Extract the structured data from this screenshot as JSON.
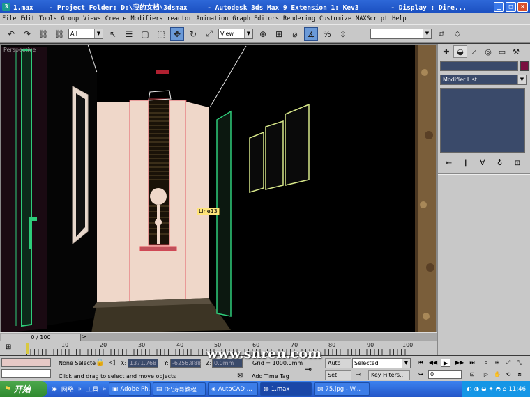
{
  "window": {
    "icon": "3ds-max-icon",
    "title": "1.max    - Project Folder: D:\\我的文档\\3dsmax     - Autodesk 3ds Max 9 Extension 1: Kev3        - Display : Dire...",
    "controls": {
      "minimize": "_",
      "maximize": "□",
      "close": "×"
    }
  },
  "menu": [
    "File",
    "Edit",
    "Tools",
    "Group",
    "Views",
    "Create",
    "Modifiers",
    "reactor",
    "Animation",
    "Graph Editors",
    "Rendering",
    "Customize",
    "MAXScript",
    "Help"
  ],
  "toolbar": {
    "undo": "↶",
    "redo": "↷",
    "link": "⛓",
    "unlink": "⛓",
    "selection_filter": "All",
    "select": "↖",
    "select_by_name": "☰",
    "region": "▢",
    "window_crossing": "⬚",
    "move": "✥",
    "rotate": "↻",
    "scale": "⤢",
    "ref_coord": "View",
    "pivot": "⊕",
    "manipulate": "⊞",
    "snap": "⌀",
    "angle_snap": "∡",
    "percent_snap": "%",
    "spinner_snap": "⇳",
    "named_selection": "",
    "mirror": "⧉",
    "align": "⬦"
  },
  "viewport": {
    "label": "Perspective",
    "object_tag": "Line13"
  },
  "command_panel": {
    "tabs": [
      "✚",
      "◒",
      "⊿",
      "◎",
      "▭",
      "⚒"
    ],
    "modifier_list": "Modifier List",
    "stack_tools": [
      "⇤",
      "‖",
      "∀",
      "♁",
      "⊡"
    ]
  },
  "time": {
    "slider": "0 / 100",
    "frames": [
      "10",
      "20",
      "30",
      "40",
      "50",
      "60",
      "70",
      "80",
      "90",
      "100"
    ]
  },
  "status": {
    "selection": "None Selecte",
    "x_label": "X:",
    "x_value": "1371.768",
    "y_label": "Y:",
    "y_value": "-6256.888",
    "z_label": "Z:",
    "z_value": "0.0mm",
    "grid": "Grid = 1000.0mm",
    "prompt": "Click and drag to select and move objects",
    "add_time_tag": "Add Time Tag",
    "auto_key": "Auto Key",
    "auto_key_mode": "Selected",
    "set_key": "Set Key",
    "key_filters": "Key Filters...",
    "current_frame": "0"
  },
  "watermark": "www.snren.com",
  "taskbar": {
    "start": "开始",
    "tools": [
      "网络",
      "工具"
    ],
    "buttons": [
      "Adobe Ph...",
      "D:\\涛哥教程",
      "AutoCAD ...",
      "1.max",
      "75.jpg - W..."
    ],
    "clock": "11:46"
  },
  "colors": {
    "title_blue": "#1b4fc0",
    "wall_pink": "#efd7c9",
    "edge_green": "#2ecc7a",
    "selected_red": "#e04050",
    "taskbar_blue": "#2356c8"
  }
}
